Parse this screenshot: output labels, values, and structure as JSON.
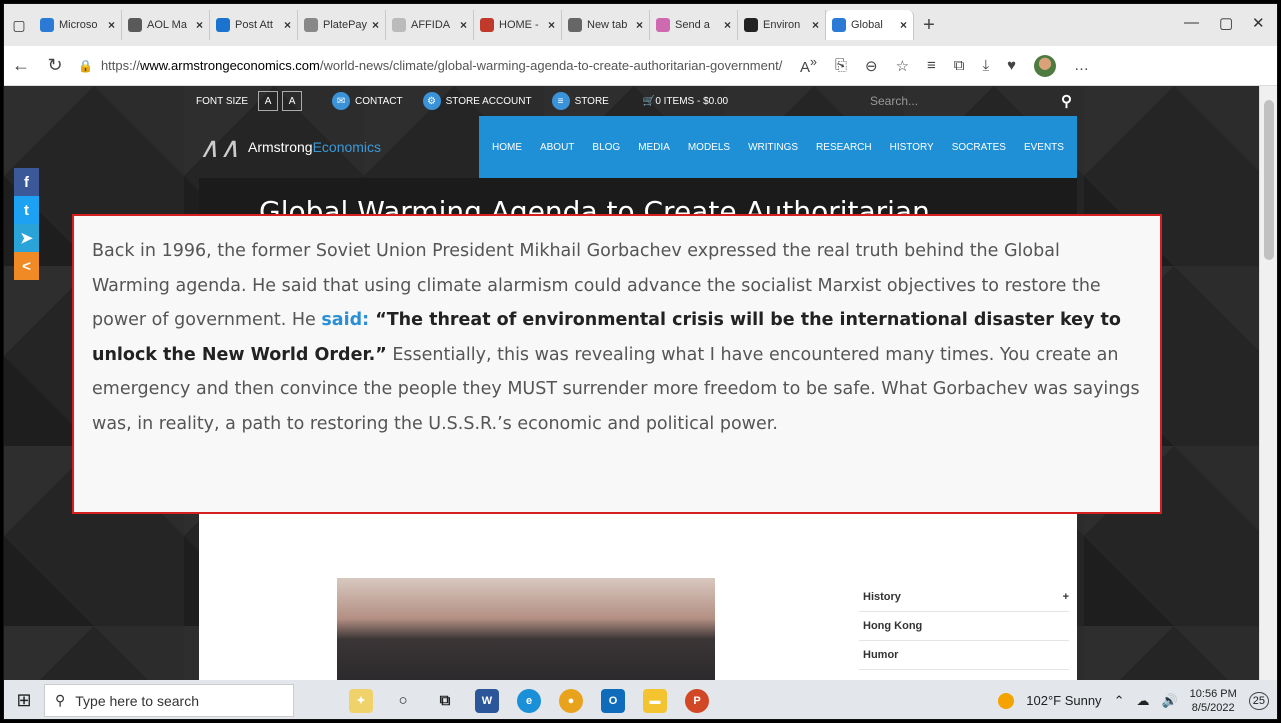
{
  "browser": {
    "tabs": [
      {
        "label": "Microso",
        "icon": "bing-icon",
        "color": "#2b7bd6",
        "active": false
      },
      {
        "label": "AOL Ma",
        "icon": "aol-mail-icon",
        "color": "#5a5a5a",
        "active": false
      },
      {
        "label": "Post Att",
        "icon": "outlook-icon",
        "color": "#1b73d0",
        "active": false
      },
      {
        "label": "PlatePay",
        "icon": "platepay-icon",
        "color": "#888888",
        "active": false
      },
      {
        "label": "AFFIDA",
        "icon": "document-icon",
        "color": "#bbbbbb",
        "active": false
      },
      {
        "label": "HOME -",
        "icon": "home-site-icon",
        "color": "#c0392b",
        "active": false
      },
      {
        "label": "New tab",
        "icon": "newtab-icon",
        "color": "#666666",
        "active": false
      },
      {
        "label": "Send a",
        "icon": "mail-icon",
        "color": "#d06ab0",
        "active": false
      },
      {
        "label": "Environ",
        "icon": "environ-icon",
        "color": "#222222",
        "active": false
      },
      {
        "label": "Global",
        "icon": "armstrong-icon",
        "color": "#2b7bd6",
        "active": true
      }
    ],
    "url_scheme": "https://",
    "url_host": "www.armstrongeconomics.com",
    "url_path": "/world-news/climate/global-warming-agenda-to-create-authoritarian-government/"
  },
  "site": {
    "font_size_label": "FONT SIZE",
    "font_small": "A",
    "font_large": "A",
    "contact": "CONTACT",
    "store_account": "STORE ACCOUNT",
    "store": "STORE",
    "cart": "0 ITEMS - $0.00",
    "search_placeholder": "Search...",
    "logo_text_1": "Armstrong",
    "logo_text_2": "Economics",
    "nav": [
      "HOME",
      "ABOUT",
      "BLOG",
      "MEDIA",
      "MODELS",
      "WRITINGS",
      "RESEARCH",
      "HISTORY",
      "SOCRATES",
      "EVENTS"
    ],
    "title": "Global Warming Agenda to Create Authoritarian Government",
    "sidebar": [
      "History",
      "Hong Kong",
      "Humor"
    ],
    "sidebar_expand": "+"
  },
  "callout": {
    "text_1": "Back in 1996, the former Soviet Union President Mikhail Gorbachev expressed the real truth behind the Global Warming agenda. He said that using climate alarmism could advance the socialist Marxist objectives to restore the power of government. He ",
    "link": "said:",
    "quote": " “The threat of environmental crisis will be the international disaster key to unlock the New World Order.”",
    "text_2": " Essentially, this was revealing what I have encountered many times. You create an emergency and then convince the people they MUST surrender more freedom to be safe. What Gorbachev was sayings was, in reality, a path to restoring the U.S.S.R.’s economic and political power."
  },
  "social": [
    {
      "icon": "facebook-icon",
      "glyph": "f",
      "color": "#3b5998"
    },
    {
      "icon": "twitter-icon",
      "glyph": "t",
      "color": "#1da1f2"
    },
    {
      "icon": "telegram-icon",
      "glyph": "➤",
      "color": "#2aa3d8"
    },
    {
      "icon": "share-icon",
      "glyph": "<",
      "color": "#f08a24"
    }
  ],
  "taskbar": {
    "search_placeholder": "Type here to search",
    "weather": "102°F  Sunny",
    "time": "10:56 PM",
    "date": "8/5/2022",
    "notifications": "25"
  }
}
